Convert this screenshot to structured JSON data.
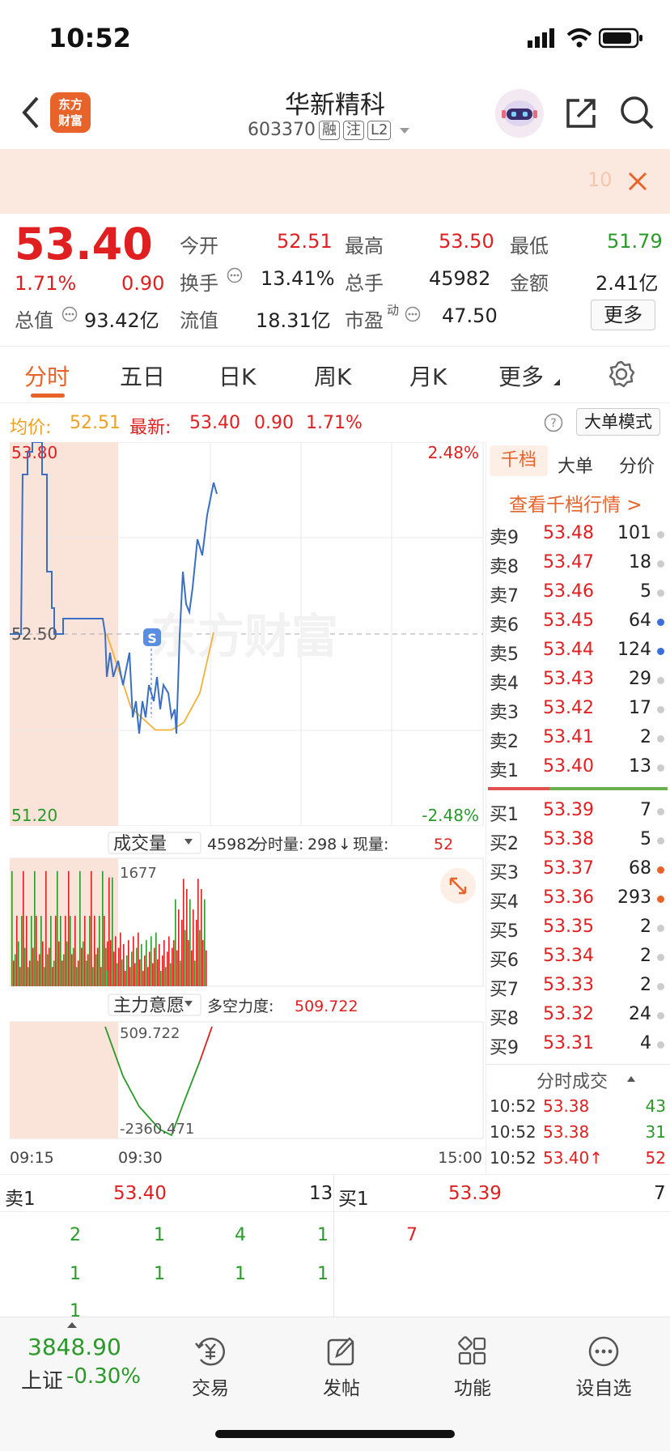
{
  "status_bar": {
    "time": "10:52"
  },
  "header": {
    "title": "华新精科",
    "code": "603370",
    "tags": [
      "融",
      "注",
      "L2"
    ],
    "logo_text": [
      "东方",
      "财富"
    ]
  },
  "banner": {
    "partial_text": "10"
  },
  "quote": {
    "price": "53.40",
    "change_pct": "1.71%",
    "change": "0.90",
    "market_cap_label": "总值",
    "market_cap": "93.42亿",
    "fields": {
      "open_label": "今开",
      "open": "52.51",
      "high_label": "最高",
      "high": "53.50",
      "low_label": "最低",
      "low": "51.79",
      "turnover_label": "换手",
      "turnover": "13.41%",
      "volume_label": "总手",
      "volume": "45982",
      "amount_label": "金额",
      "amount": "2.41亿",
      "float_label": "流值",
      "float": "18.31亿",
      "pe_label": "市盈",
      "pe_sup": "动",
      "pe": "47.50",
      "more_label": "更多"
    }
  },
  "tabs": [
    "分时",
    "五日",
    "日K",
    "周K",
    "月K",
    "更多"
  ],
  "info": {
    "avg_label": "均价:",
    "avg": "52.51",
    "latest_label": "最新:",
    "latest": "53.40",
    "chg": "0.90",
    "pct": "1.71%",
    "mode_label": "大单模式"
  },
  "price_chart": {
    "top_left": "53.80",
    "mid_left": "52.50",
    "bottom_left": "51.20",
    "top_right": "2.48%",
    "bottom_right": "-2.48%",
    "watermark": "东方财富",
    "marker": "S"
  },
  "volume_bar": {
    "selector": "成交量",
    "total": "45982",
    "minute_label": "分时量:",
    "minute": "298",
    "now_label": "现量:",
    "now": "52",
    "max_label": "1677"
  },
  "force": {
    "selector": "主力意愿",
    "label": "多空力度:",
    "value": "509.722",
    "top": "509.722",
    "bottom": "-2360.471"
  },
  "time_axis": [
    "09:15",
    "09:30",
    "15:00"
  ],
  "order_book": {
    "tabs": [
      "千档",
      "大单",
      "分价"
    ],
    "link": "查看千档行情 >",
    "asks": [
      {
        "label": "卖9",
        "price": "53.48",
        "vol": "101",
        "dot": "#cccccc"
      },
      {
        "label": "卖8",
        "price": "53.47",
        "vol": "18",
        "dot": "#cccccc"
      },
      {
        "label": "卖7",
        "price": "53.46",
        "vol": "5",
        "dot": "#cccccc"
      },
      {
        "label": "卖6",
        "price": "53.45",
        "vol": "64",
        "dot": "#3b6fd8"
      },
      {
        "label": "卖5",
        "price": "53.44",
        "vol": "124",
        "dot": "#3b6fd8"
      },
      {
        "label": "卖4",
        "price": "53.43",
        "vol": "29",
        "dot": "#cccccc"
      },
      {
        "label": "卖3",
        "price": "53.42",
        "vol": "17",
        "dot": "#cccccc"
      },
      {
        "label": "卖2",
        "price": "53.41",
        "vol": "2",
        "dot": "#cccccc"
      },
      {
        "label": "卖1",
        "price": "53.40",
        "vol": "13",
        "dot": "#cccccc"
      }
    ],
    "bids": [
      {
        "label": "买1",
        "price": "53.39",
        "vol": "7",
        "dot": "#cccccc"
      },
      {
        "label": "买2",
        "price": "53.38",
        "vol": "5",
        "dot": "#cccccc"
      },
      {
        "label": "买3",
        "price": "53.37",
        "vol": "68",
        "dot": "#e8632a"
      },
      {
        "label": "买4",
        "price": "53.36",
        "vol": "293",
        "dot": "#e8632a"
      },
      {
        "label": "买5",
        "price": "53.35",
        "vol": "2",
        "dot": "#cccccc"
      },
      {
        "label": "买6",
        "price": "53.34",
        "vol": "2",
        "dot": "#cccccc"
      },
      {
        "label": "买7",
        "price": "53.33",
        "vol": "2",
        "dot": "#cccccc"
      },
      {
        "label": "买8",
        "price": "53.32",
        "vol": "24",
        "dot": "#cccccc"
      },
      {
        "label": "买9",
        "price": "53.31",
        "vol": "4",
        "dot": "#cccccc"
      }
    ],
    "trades_header": "分时成交",
    "trades": [
      {
        "time": "10:52",
        "price": "53.38",
        "vol": "43",
        "color": "#2a9a2a"
      },
      {
        "time": "10:52",
        "price": "53.38",
        "vol": "31",
        "color": "#2a9a2a"
      },
      {
        "time": "10:52",
        "price": "53.40↑",
        "vol": "52",
        "color": "#e02020"
      }
    ]
  },
  "strip": {
    "sell_label": "卖1",
    "sell_price": "53.40",
    "sell_vol": "13",
    "buy_label": "买1",
    "buy_price": "53.39",
    "buy_vol": "7",
    "row1": [
      "2",
      "1",
      "4",
      "1"
    ],
    "row2": [
      "1",
      "1",
      "1",
      "1"
    ],
    "row3": [
      "1"
    ],
    "buy_row1": "7"
  },
  "bottom_nav": {
    "index_value": "3848.90",
    "index_label": "上证",
    "index_change": "-0.30%",
    "items": [
      "交易",
      "发帖",
      "功能",
      "设自选"
    ]
  },
  "chart_data": [
    {
      "type": "line",
      "title": "分时",
      "x": [
        "09:15",
        "09:30",
        "15:00"
      ],
      "ylim": [
        51.2,
        53.8
      ],
      "series": [
        {
          "values": [
            52.5,
            53.8,
            53.8,
            52.5,
            52.55,
            52.55,
            51.8,
            51.6,
            51.95,
            51.7,
            51.75,
            52.55,
            52.5,
            52.9,
            53.4
          ]
        },
        {
          "values": [
            52.5,
            52.0,
            51.85,
            51.85,
            51.9,
            52.1,
            52.51
          ]
        }
      ]
    },
    {
      "type": "bar",
      "title": "成交量",
      "ylim": [
        0,
        1677
      ],
      "max_label": "1677"
    },
    {
      "type": "line",
      "title": "主力意愿",
      "ylim": [
        -2360.471,
        509.722
      ],
      "series": [
        {
          "name": "多空力度",
          "values": [
            509.722,
            -800,
            -1600,
            -2200,
            -2360.471,
            -1500,
            -400,
            509.722
          ]
        }
      ]
    }
  ],
  "colors": {
    "red": "#e02020",
    "green": "#2a9a2a",
    "orange": "#f06522",
    "blue": "#3a6fc4",
    "avg_line": "#f0b23a"
  }
}
